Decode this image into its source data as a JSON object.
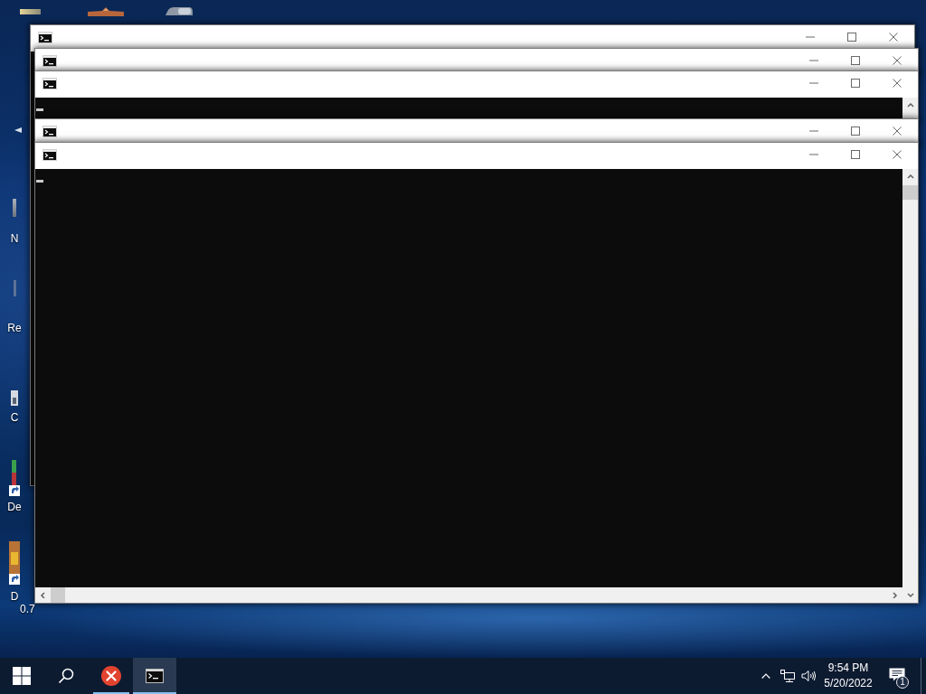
{
  "desktop": {
    "icons": [
      {
        "label": "N"
      },
      {
        "label": "Re"
      },
      {
        "label": "C"
      },
      {
        "label": "De"
      },
      {
        "label": "D",
        "label_2": "0.7"
      }
    ]
  },
  "taskbar": {
    "apps": [
      {
        "kind": "error",
        "running": true,
        "selected": false
      },
      {
        "kind": "console",
        "running": true,
        "selected": true
      }
    ],
    "clock": {
      "time": "9:54 PM",
      "date": "5/20/2022"
    },
    "notifications": {
      "count": "1"
    }
  }
}
